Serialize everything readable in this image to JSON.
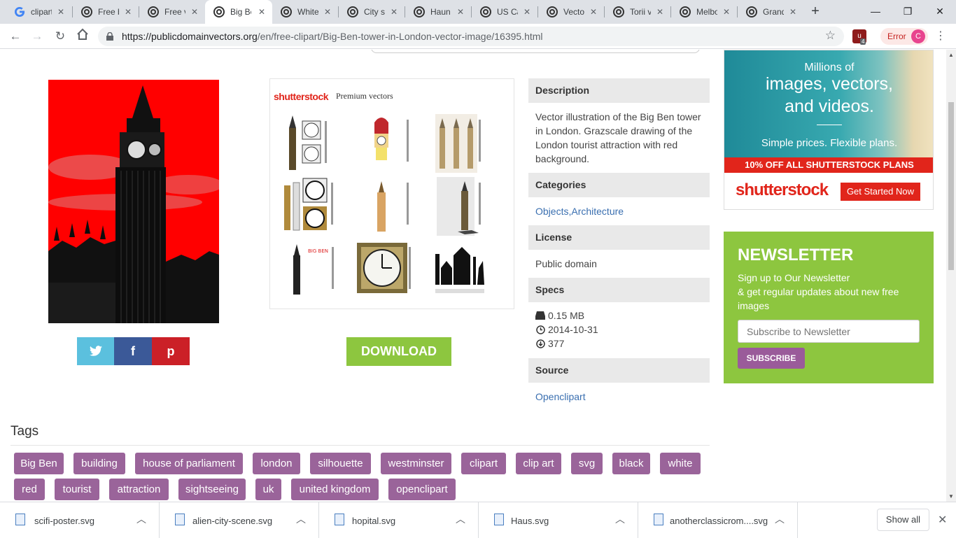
{
  "browser": {
    "tabs": [
      {
        "title": "clipart",
        "favicon": "google-g-icon",
        "active": false
      },
      {
        "title": "Free b",
        "favicon": "pdv-icon",
        "active": false
      },
      {
        "title": "Free v",
        "favicon": "pdv-icon",
        "active": false
      },
      {
        "title": "Big Be",
        "favicon": "pdv-icon",
        "active": true
      },
      {
        "title": "White",
        "favicon": "pdv-icon",
        "active": false
      },
      {
        "title": "City sk",
        "favicon": "pdv-icon",
        "active": false
      },
      {
        "title": "Haun",
        "favicon": "pdv-icon",
        "active": false
      },
      {
        "title": "US Ca",
        "favicon": "pdv-icon",
        "active": false
      },
      {
        "title": "Vecto",
        "favicon": "pdv-icon",
        "active": false
      },
      {
        "title": "Torii v",
        "favicon": "pdv-icon",
        "active": false
      },
      {
        "title": "Melbo",
        "favicon": "pdv-icon",
        "active": false
      },
      {
        "title": "Grand",
        "favicon": "pdv-icon",
        "active": false
      }
    ],
    "url_host": "https://publicdomainvectors.org",
    "url_path": "/en/free-clipart/Big-Ben-tower-in-London-vector-image/16395.html",
    "extension_badge": "4",
    "error_label": "Error",
    "profile_initial": "C"
  },
  "share": {
    "twitter": "t",
    "facebook": "f",
    "pinterest": "p"
  },
  "shutterstock": {
    "logo": "shutterstock",
    "label": "Premium vectors"
  },
  "download_label": "DOWNLOAD",
  "info": {
    "description_head": "Description",
    "description_text": "Vector illustration of the Big Ben tower in London. Grazscale drawing of the London tourist attraction with red background.",
    "categories_head": "Categories",
    "categories_links": [
      "Objects",
      "Architecture"
    ],
    "license_head": "License",
    "license_text": "Public domain",
    "specs_head": "Specs",
    "spec_size": "0.15 MB",
    "spec_date": "2014-10-31",
    "spec_downloads": "377",
    "source_head": "Source",
    "source_link": "Openclipart"
  },
  "ad": {
    "line1": "Millions of",
    "line2": "images, vectors,",
    "line3": "and videos.",
    "line4": "Simple prices. Flexible plans.",
    "promo": "10% OFF ALL SHUTTERSTOCK PLANS",
    "brand": "shutterstock",
    "cta": "Get Started Now"
  },
  "newsletter": {
    "title": "NEWSLETTER",
    "subtitle_1": "Sign up to Our Newsletter",
    "subtitle_2": "& get regular updates about new free images",
    "placeholder": "Subscribe to Newsletter",
    "button": "SUBSCRIBE"
  },
  "tags": {
    "title": "Tags",
    "items": [
      "Big Ben",
      "building",
      "house of parliament",
      "london",
      "silhouette",
      "westminster",
      "clipart",
      "clip art",
      "svg",
      "black",
      "white",
      "red",
      "tourist",
      "attraction",
      "sightseeing",
      "uk",
      "united kingdom",
      "openclipart"
    ]
  },
  "downloads": {
    "files": [
      "scifi-poster.svg",
      "alien-city-scene.svg",
      "hopital.svg",
      "Haus.svg",
      "anotherclassicrom....svg"
    ],
    "show_all": "Show all"
  },
  "colors": {
    "accent_green": "#8dc63f",
    "tag_purple": "#9a649a",
    "shutter_red": "#e1251b",
    "link_blue": "#3a6fb0"
  }
}
